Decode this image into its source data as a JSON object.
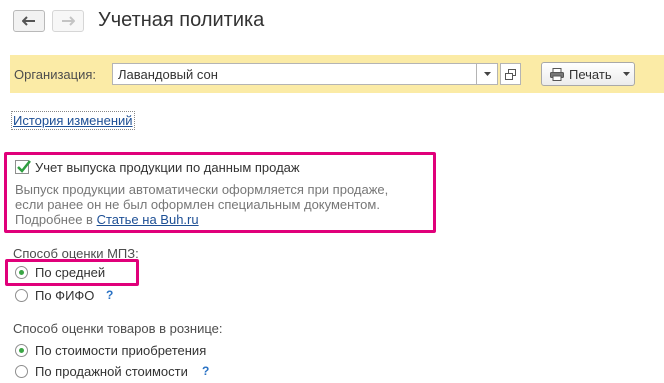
{
  "header": {
    "title": "Учетная политика",
    "back_icon": "arrow-left-icon",
    "forward_icon": "arrow-right-icon"
  },
  "organization": {
    "label": "Организация:",
    "value": "Лавандовый сон",
    "print_label": "Печать"
  },
  "history_link": "История изменений",
  "production_option": {
    "checked": true,
    "label": "Учет выпуска продукции по данным продаж",
    "hint_line1": "Выпуск продукции автоматически оформляется при продаже,",
    "hint_line2": "если ранее он не был оформлен специальным документом.",
    "hint_more": "Подробнее в ",
    "hint_link": "Статье на Buh.ru"
  },
  "mpz_valuation": {
    "label": "Способ оценки МПЗ:",
    "options": [
      {
        "label": "По средней",
        "selected": true
      },
      {
        "label": "По ФИФО",
        "selected": false,
        "help": "?"
      }
    ]
  },
  "retail_valuation": {
    "label": "Способ оценки товаров в рознице:",
    "options": [
      {
        "label": "По стоимости приобретения",
        "selected": true
      },
      {
        "label": "По продажной стоимости",
        "selected": false,
        "help": "?"
      }
    ]
  },
  "colors": {
    "highlight": "#e0007a",
    "org_bar": "#fbeba6",
    "link": "#1d4f95",
    "radio_on": "#3aa544"
  }
}
